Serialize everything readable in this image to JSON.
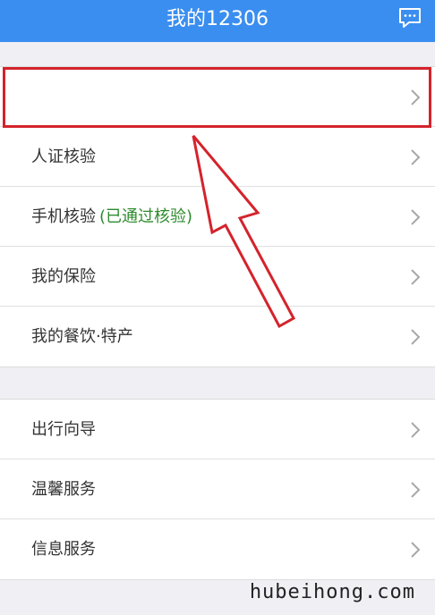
{
  "header": {
    "title": "我的12306",
    "message_icon": "chat-bubble-icon"
  },
  "section1": {
    "items": [
      {
        "label": ""
      },
      {
        "label": "人证核验"
      },
      {
        "label": "手机核验",
        "note": "(已通过核验)"
      },
      {
        "label": "我的保险"
      },
      {
        "label": "我的餐饮·特产"
      }
    ]
  },
  "section2": {
    "items": [
      {
        "label": "出行向导"
      },
      {
        "label": "温馨服务"
      },
      {
        "label": "信息服务"
      }
    ]
  },
  "annotation": {
    "highlight_color": "#d4232c",
    "arrow_icon": "pointer-arrow-icon"
  },
  "watermark": "hubeihong.com",
  "colors": {
    "header_bg": "#3a8ef0",
    "verified_text": "#2e8b2e"
  }
}
